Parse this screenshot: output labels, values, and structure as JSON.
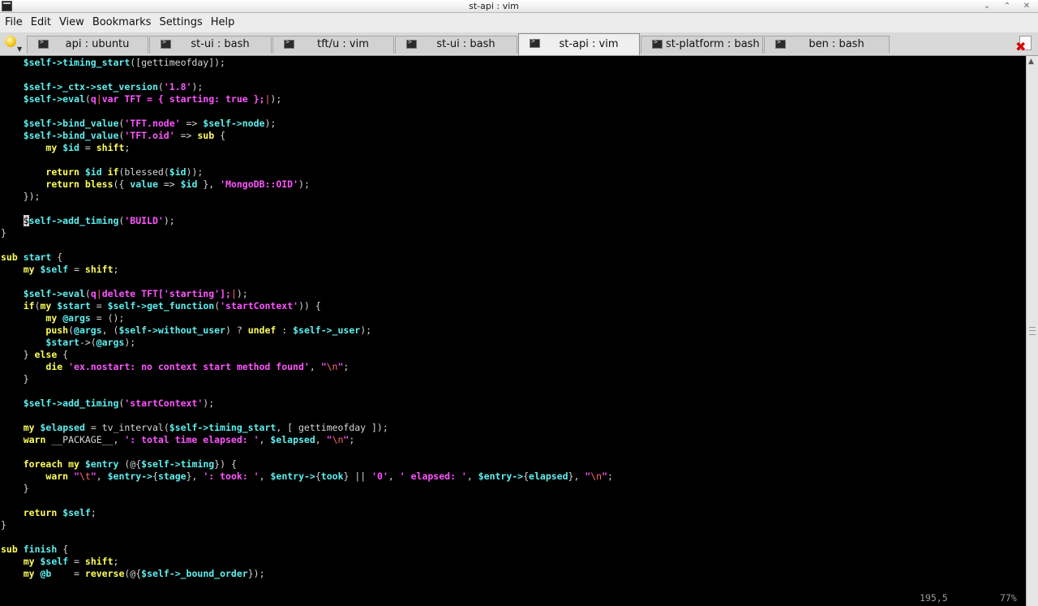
{
  "window": {
    "title": "st-api : vim"
  },
  "menu": [
    "File",
    "Edit",
    "View",
    "Bookmarks",
    "Settings",
    "Help"
  ],
  "tabs": [
    {
      "label": "api : ubuntu",
      "active": false
    },
    {
      "label": "st-ui : bash",
      "active": false
    },
    {
      "label": "tft/u : vim",
      "active": false
    },
    {
      "label": "st-ui : bash",
      "active": false
    },
    {
      "label": "st-api : vim",
      "active": true
    },
    {
      "label": "st-platform : bash",
      "active": false
    },
    {
      "label": "ben : bash",
      "active": false
    }
  ],
  "editor": {
    "lines": [
      [
        [
          "n",
          "    "
        ],
        [
          "v",
          "$self->timing_start"
        ],
        [
          "n",
          "([gettimeofday]);"
        ]
      ],
      [],
      [
        [
          "n",
          "    "
        ],
        [
          "v",
          "$self->_ctx->set_version"
        ],
        [
          "n",
          "("
        ],
        [
          "s",
          "'1.8'"
        ],
        [
          "n",
          ");"
        ]
      ],
      [
        [
          "n",
          "    "
        ],
        [
          "v",
          "$self->eval"
        ],
        [
          "n",
          "("
        ],
        [
          "s",
          "q"
        ],
        [
          "a",
          "|"
        ],
        [
          "s",
          "var TFT = { starting: true };"
        ],
        [
          "a",
          "|"
        ],
        [
          "n",
          ");"
        ]
      ],
      [],
      [
        [
          "n",
          "    "
        ],
        [
          "v",
          "$self->bind_value"
        ],
        [
          "n",
          "("
        ],
        [
          "s",
          "'TFT.node'"
        ],
        [
          "n",
          " => "
        ],
        [
          "v",
          "$self->node"
        ],
        [
          "n",
          ");"
        ]
      ],
      [
        [
          "n",
          "    "
        ],
        [
          "v",
          "$self->bind_value"
        ],
        [
          "n",
          "("
        ],
        [
          "s",
          "'TFT.oid'"
        ],
        [
          "n",
          " => "
        ],
        [
          "k",
          "sub"
        ],
        [
          "n",
          " {"
        ]
      ],
      [
        [
          "n",
          "        "
        ],
        [
          "k",
          "my"
        ],
        [
          "n",
          " "
        ],
        [
          "v",
          "$id"
        ],
        [
          "n",
          " = "
        ],
        [
          "k",
          "shift"
        ],
        [
          "n",
          ";"
        ]
      ],
      [],
      [
        [
          "n",
          "        "
        ],
        [
          "k",
          "return"
        ],
        [
          "n",
          " "
        ],
        [
          "v",
          "$id"
        ],
        [
          "n",
          " "
        ],
        [
          "k",
          "if"
        ],
        [
          "n",
          "(blessed("
        ],
        [
          "v",
          "$id"
        ],
        [
          "n",
          "));"
        ]
      ],
      [
        [
          "n",
          "        "
        ],
        [
          "k",
          "return"
        ],
        [
          "n",
          " "
        ],
        [
          "k",
          "bless"
        ],
        [
          "n",
          "({ "
        ],
        [
          "v",
          "value"
        ],
        [
          "n",
          " => "
        ],
        [
          "v",
          "$id"
        ],
        [
          "n",
          " }, "
        ],
        [
          "s",
          "'MongoDB::OID'"
        ],
        [
          "n",
          ");"
        ]
      ],
      [
        [
          "n",
          "    });"
        ]
      ],
      [],
      [
        [
          "n",
          "    "
        ],
        [
          "cur",
          "$"
        ],
        [
          "v",
          "self->add_timing"
        ],
        [
          "n",
          "("
        ],
        [
          "s",
          "'BUILD'"
        ],
        [
          "n",
          ");"
        ]
      ],
      [
        [
          "n",
          "}"
        ]
      ],
      [],
      [
        [
          "k",
          "sub"
        ],
        [
          "n",
          " "
        ],
        [
          "v",
          "start"
        ],
        [
          "n",
          " {"
        ]
      ],
      [
        [
          "n",
          "    "
        ],
        [
          "k",
          "my"
        ],
        [
          "n",
          " "
        ],
        [
          "v",
          "$self"
        ],
        [
          "n",
          " = "
        ],
        [
          "k",
          "shift"
        ],
        [
          "n",
          ";"
        ]
      ],
      [],
      [
        [
          "n",
          "    "
        ],
        [
          "v",
          "$self->eval"
        ],
        [
          "n",
          "("
        ],
        [
          "s",
          "q"
        ],
        [
          "a",
          "|"
        ],
        [
          "s",
          "delete TFT['starting'];"
        ],
        [
          "a",
          "|"
        ],
        [
          "n",
          ");"
        ]
      ],
      [
        [
          "n",
          "    "
        ],
        [
          "k",
          "if"
        ],
        [
          "n",
          "("
        ],
        [
          "k",
          "my"
        ],
        [
          "n",
          " "
        ],
        [
          "v",
          "$start"
        ],
        [
          "n",
          " = "
        ],
        [
          "v",
          "$self->get_function"
        ],
        [
          "n",
          "("
        ],
        [
          "s",
          "'startContext'"
        ],
        [
          "n",
          ")) {"
        ]
      ],
      [
        [
          "n",
          "        "
        ],
        [
          "k",
          "my"
        ],
        [
          "n",
          " "
        ],
        [
          "v",
          "@args"
        ],
        [
          "n",
          " = ();"
        ]
      ],
      [
        [
          "n",
          "        "
        ],
        [
          "k",
          "push"
        ],
        [
          "n",
          "("
        ],
        [
          "v",
          "@args"
        ],
        [
          "n",
          ", ("
        ],
        [
          "v",
          "$self->without_user"
        ],
        [
          "n",
          ") ? "
        ],
        [
          "k",
          "undef"
        ],
        [
          "n",
          " : "
        ],
        [
          "v",
          "$self->_user"
        ],
        [
          "n",
          ");"
        ]
      ],
      [
        [
          "n",
          "        "
        ],
        [
          "v",
          "$start"
        ],
        [
          "n",
          "->("
        ],
        [
          "v",
          "@args"
        ],
        [
          "n",
          ");"
        ]
      ],
      [
        [
          "n",
          "    } "
        ],
        [
          "k",
          "else"
        ],
        [
          "n",
          " {"
        ]
      ],
      [
        [
          "n",
          "        "
        ],
        [
          "k",
          "die"
        ],
        [
          "n",
          " "
        ],
        [
          "s",
          "'ex.nostart: no context start method found'"
        ],
        [
          "n",
          ", "
        ],
        [
          "s",
          "\""
        ],
        [
          "a",
          "\\n"
        ],
        [
          "s",
          "\""
        ],
        [
          "n",
          ";"
        ]
      ],
      [
        [
          "n",
          "    }"
        ]
      ],
      [],
      [
        [
          "n",
          "    "
        ],
        [
          "v",
          "$self->add_timing"
        ],
        [
          "n",
          "("
        ],
        [
          "s",
          "'startContext'"
        ],
        [
          "n",
          ");"
        ]
      ],
      [],
      [
        [
          "n",
          "    "
        ],
        [
          "k",
          "my"
        ],
        [
          "n",
          " "
        ],
        [
          "v",
          "$elapsed"
        ],
        [
          "n",
          " = tv_interval("
        ],
        [
          "v",
          "$self->timing_start"
        ],
        [
          "n",
          ", [ gettimeofday ]);"
        ]
      ],
      [
        [
          "n",
          "    "
        ],
        [
          "k",
          "warn"
        ],
        [
          "n",
          " __PACKAGE__, "
        ],
        [
          "s",
          "': total time elapsed: '"
        ],
        [
          "n",
          ", "
        ],
        [
          "v",
          "$elapsed"
        ],
        [
          "n",
          ", "
        ],
        [
          "s",
          "\""
        ],
        [
          "a",
          "\\n"
        ],
        [
          "s",
          "\""
        ],
        [
          "n",
          ";"
        ]
      ],
      [],
      [
        [
          "n",
          "    "
        ],
        [
          "k",
          "foreach"
        ],
        [
          "n",
          " "
        ],
        [
          "k",
          "my"
        ],
        [
          "n",
          " "
        ],
        [
          "v",
          "$entry"
        ],
        [
          "n",
          " (@{"
        ],
        [
          "v",
          "$self->timing"
        ],
        [
          "n",
          "}) {"
        ]
      ],
      [
        [
          "n",
          "        "
        ],
        [
          "k",
          "warn"
        ],
        [
          "n",
          " "
        ],
        [
          "s",
          "\""
        ],
        [
          "a",
          "\\t"
        ],
        [
          "s",
          "\""
        ],
        [
          "n",
          ", "
        ],
        [
          "v",
          "$entry->"
        ],
        [
          "n",
          "{"
        ],
        [
          "v",
          "stage"
        ],
        [
          "n",
          "}, "
        ],
        [
          "s",
          "': took: '"
        ],
        [
          "n",
          ", "
        ],
        [
          "v",
          "$entry->"
        ],
        [
          "n",
          "{"
        ],
        [
          "v",
          "took"
        ],
        [
          "n",
          "} || "
        ],
        [
          "s",
          "'0'"
        ],
        [
          "n",
          ", "
        ],
        [
          "s",
          "' elapsed: '"
        ],
        [
          "n",
          ", "
        ],
        [
          "v",
          "$entry->"
        ],
        [
          "n",
          "{"
        ],
        [
          "v",
          "elapsed"
        ],
        [
          "n",
          "}, "
        ],
        [
          "s",
          "\""
        ],
        [
          "a",
          "\\n"
        ],
        [
          "s",
          "\""
        ],
        [
          "n",
          ";"
        ]
      ],
      [
        [
          "n",
          "    }"
        ]
      ],
      [],
      [
        [
          "n",
          "    "
        ],
        [
          "k",
          "return"
        ],
        [
          "n",
          " "
        ],
        [
          "v",
          "$self"
        ],
        [
          "n",
          ";"
        ]
      ],
      [
        [
          "n",
          "}"
        ]
      ],
      [],
      [
        [
          "k",
          "sub"
        ],
        [
          "n",
          " "
        ],
        [
          "v",
          "finish"
        ],
        [
          "n",
          " {"
        ]
      ],
      [
        [
          "n",
          "    "
        ],
        [
          "k",
          "my"
        ],
        [
          "n",
          " "
        ],
        [
          "v",
          "$self"
        ],
        [
          "n",
          " = "
        ],
        [
          "k",
          "shift"
        ],
        [
          "n",
          ";"
        ]
      ],
      [
        [
          "n",
          "    "
        ],
        [
          "k",
          "my"
        ],
        [
          "n",
          " "
        ],
        [
          "v",
          "@b"
        ],
        [
          "n",
          "    = "
        ],
        [
          "k",
          "reverse"
        ],
        [
          "n",
          "(@{"
        ],
        [
          "v",
          "$self->_bound_order"
        ],
        [
          "n",
          "});"
        ]
      ]
    ],
    "status": {
      "position": "195,5",
      "percent": "77%"
    }
  },
  "colors": {
    "normal": "#d6d6d6",
    "keyword": "#ffff5a",
    "variable": "#5ef0f0",
    "string": "#ff55ff",
    "special": "#ff6b6b",
    "background": "#000000"
  }
}
